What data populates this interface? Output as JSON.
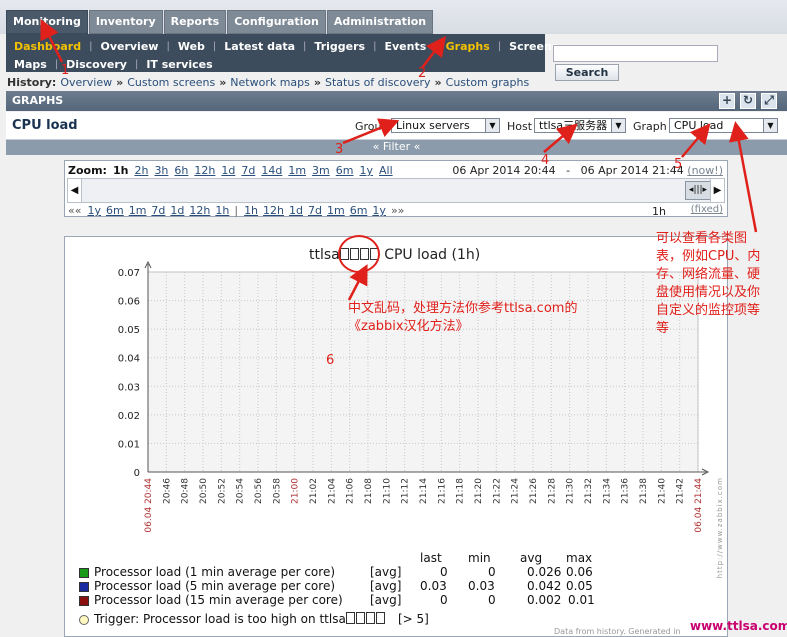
{
  "top_tabs": [
    "Monitoring",
    "Inventory",
    "Reports",
    "Configuration",
    "Administration"
  ],
  "sub_menu_row1": [
    "Dashboard",
    "Overview",
    "Web",
    "Latest data",
    "Triggers",
    "Events",
    "Graphs",
    "Screens"
  ],
  "sub_menu_row2": [
    "Maps",
    "Discovery",
    "IT services"
  ],
  "search": {
    "button": "Search",
    "value": ""
  },
  "history": {
    "label": "History:",
    "links": [
      "Overview",
      "Custom screens",
      "Network maps",
      "Status of discovery",
      "Custom graphs"
    ]
  },
  "graphs_header": {
    "title": "GRAPHS"
  },
  "cpu_row": {
    "title": "CPU load",
    "group_label": "Group",
    "group_value": "Linux servers",
    "host_label": "Host",
    "host_value": "ttlsa三服务器",
    "graph_label": "Graph",
    "graph_value": "CPU load"
  },
  "filter": {
    "label": "« Filter «"
  },
  "zoom": {
    "label": "Zoom:",
    "links": [
      "1h",
      "2h",
      "3h",
      "6h",
      "12h",
      "1d",
      "7d",
      "14d",
      "1m",
      "3m",
      "6m",
      "1y",
      "All"
    ],
    "range_start": "06 Apr 2014 20:44",
    "range_dash": "-",
    "range_end": "06 Apr 2014 21:44",
    "now": "(now!)",
    "back_links": [
      "1y",
      "6m",
      "1m",
      "7d",
      "1d",
      "12h",
      "1h"
    ],
    "fwd_links": [
      "1h",
      "12h",
      "1d",
      "7d",
      "1m",
      "6m",
      "1y"
    ],
    "period": "1h",
    "fixed": "(fixed)"
  },
  "graph": {
    "title_prefix": "ttlsa",
    "title_suffix": "CPU load (1h)",
    "footer": "Data from history. Generated in",
    "watermark": "http://www.zabbix.com",
    "site": "www.ttlsa.com"
  },
  "chart_data": {
    "type": "line",
    "title": "ttlsa CPU load (1h)",
    "ylim": [
      0,
      0.07
    ],
    "yticks": [
      "0.07",
      "0.06",
      "0.05",
      "0.04",
      "0.03",
      "0.02",
      "0.01",
      "0"
    ],
    "xticks": [
      "06.04 20:44",
      "20:46",
      "20:48",
      "20:50",
      "20:52",
      "20:54",
      "20:56",
      "20:58",
      "21:00",
      "21:02",
      "21:04",
      "21:06",
      "21:08",
      "21:10",
      "21:12",
      "21:14",
      "21:16",
      "21:18",
      "21:20",
      "21:22",
      "21:24",
      "21:26",
      "21:28",
      "21:30",
      "21:32",
      "21:34",
      "21:36",
      "21:38",
      "21:40",
      "21:42",
      "06.04 21:44"
    ],
    "xticks_red": [
      "06.04 20:44",
      "21:00",
      "06.04 21:44"
    ],
    "grid": true,
    "series": [
      {
        "name": "Processor load (1 min average per core)",
        "color": "#1a9a1a",
        "agg": "[avg]",
        "last": "0",
        "min": "0",
        "avg": "0.026",
        "max": "0.06",
        "points": [
          [
            57.0,
            0.05
          ],
          [
            57.5,
            0.02
          ],
          [
            58.0,
            0.04
          ],
          [
            58.5,
            0.01
          ],
          [
            59.0,
            0
          ]
        ]
      },
      {
        "name": "Processor load (5 min average per core)",
        "color": "#1a2aa0",
        "agg": "[avg]",
        "last": "0.03",
        "min": "0.03",
        "avg": "0.042",
        "max": "0.05",
        "points": [
          [
            57.0,
            0.047
          ],
          [
            57.5,
            0.04
          ],
          [
            58.0,
            0.05
          ],
          [
            58.5,
            0.04
          ],
          [
            59.0,
            0.03
          ]
        ]
      },
      {
        "name": "Processor load (15 min average per core)",
        "color": "#8a1010",
        "agg": "[avg]",
        "last": "0",
        "min": "0",
        "avg": "0.002",
        "max": "0.01",
        "points": [
          [
            57.0,
            0.01
          ],
          [
            57.5,
            0.0
          ],
          [
            58.0,
            0.0
          ],
          [
            58.5,
            0.0
          ],
          [
            59.0,
            0.0
          ]
        ]
      }
    ],
    "stat_headers": [
      "last",
      "min",
      "avg",
      "max"
    ],
    "trigger": {
      "text_prefix": "Trigger: Processor load is too high on ttlsa",
      "threshold": "[> 5]"
    }
  },
  "annotations": {
    "n1": "1",
    "n2": "2",
    "n3": "3",
    "n4": "4",
    "n5": "5",
    "n6": "6",
    "note_graph_lines": [
      "可以查看各类图",
      "表，例如CPU、内",
      "存、网络流量、硬",
      "盘使用情况以及你",
      "自定义的监控项等",
      "等"
    ],
    "note_garbled_lines": [
      "中文乱码，处理方法你参考ttlsa.com的",
      "《zabbix汉化方法》"
    ]
  },
  "colors": {
    "accent": "#e0201a",
    "nav_dark": "#3d4c5c",
    "selected": "#f5c200"
  }
}
